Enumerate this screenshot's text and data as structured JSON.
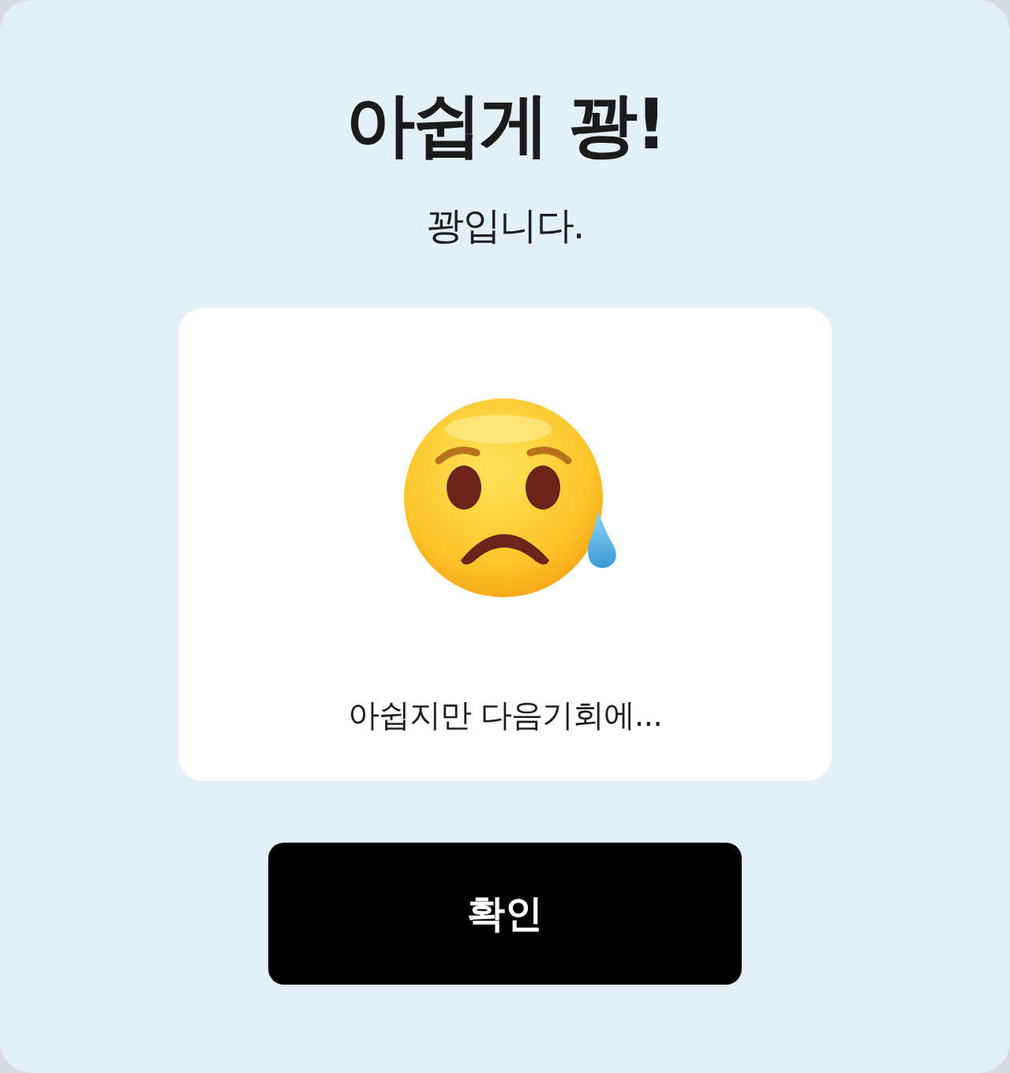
{
  "dialog": {
    "title": "아쉽게 꽝!",
    "subtitle": "꽝입니다.",
    "result_card": {
      "message": "아쉽지만 다음기회에..."
    },
    "buttons": [
      {
        "label": "확인"
      }
    ]
  }
}
